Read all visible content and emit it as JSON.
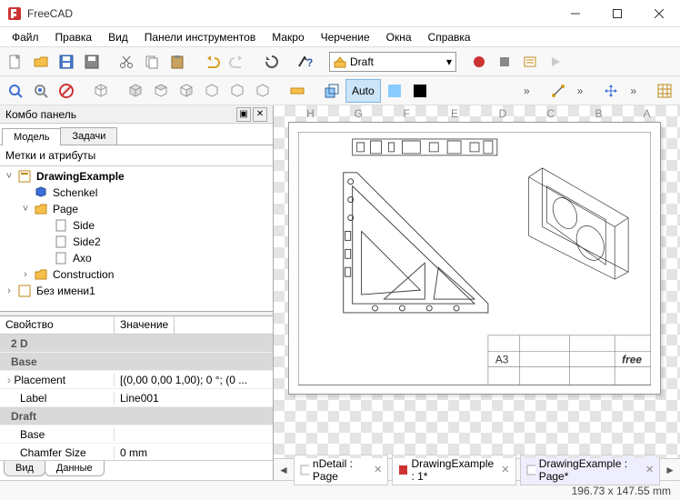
{
  "window": {
    "title": "FreeCAD"
  },
  "menu": [
    "Файл",
    "Правка",
    "Вид",
    "Панели инструментов",
    "Макро",
    "Черчение",
    "Окна",
    "Справка"
  ],
  "workbench": {
    "current": "Draft"
  },
  "toolbar2": {
    "auto": "Auto"
  },
  "combo": {
    "title": "Комбо панель",
    "tabs": {
      "model": "Модель",
      "tasks": "Задачи"
    },
    "tree_header": "Метки и атрибуты",
    "tree": {
      "root": "DrawingExample",
      "schenkel": "Schenkel",
      "page": "Page",
      "side": "Side",
      "side2": "Side2",
      "axo": "Axo",
      "construction": "Construction",
      "unnamed": "Без имени1"
    },
    "props": {
      "col1": "Свойство",
      "col2": "Значение",
      "groups": {
        "g2d": "2 D",
        "base": "Base",
        "draft": "Draft"
      },
      "rows": {
        "placement_k": "Placement",
        "placement_v": "[(0,00 0,00 1,00); 0 °; (0 ...",
        "label_k": "Label",
        "label_v": "Line001",
        "base2": "Base",
        "chamfer_k": "Chamfer Size",
        "chamfer_v": "0 mm"
      },
      "tabs": {
        "view": "Вид",
        "data": "Данные"
      }
    }
  },
  "canvas": {
    "rulers": [
      "H",
      "G",
      "F",
      "E",
      "D",
      "C",
      "B",
      "A"
    ],
    "titleblock": "A3",
    "brand": "free"
  },
  "mdi": {
    "tabs": [
      {
        "label": "nDetail : Page"
      },
      {
        "label": "DrawingExample : 1*"
      },
      {
        "label": "DrawingExample : Page*"
      }
    ]
  },
  "status": {
    "coords": "196.73 x 147.55 mm"
  }
}
